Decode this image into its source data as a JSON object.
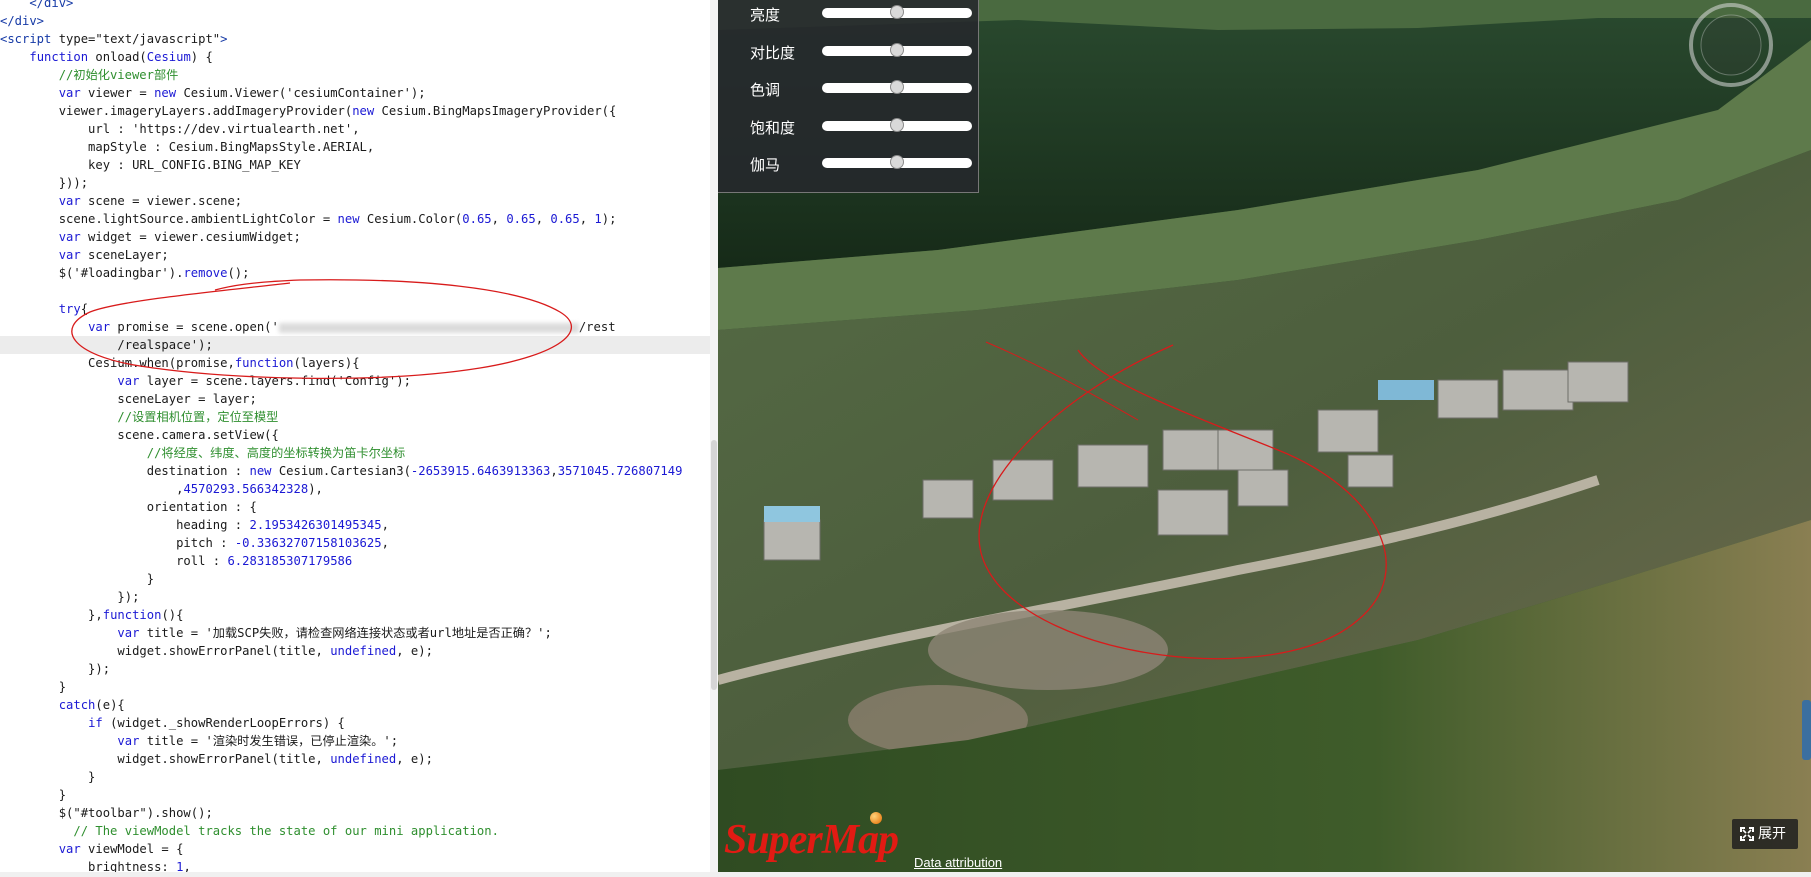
{
  "editor": {
    "lines": [
      [
        [
          "tag",
          "    </div>"
        ]
      ],
      [
        [
          "tag",
          "</div>"
        ]
      ],
      [
        [
          "tag",
          "<script "
        ],
        [
          "plain",
          "type=\"text/javascript\""
        ],
        [
          "tag",
          ">"
        ]
      ],
      [
        [
          "plain",
          "    "
        ],
        [
          "kw",
          "function"
        ],
        [
          "plain",
          " onload("
        ],
        [
          "kw",
          "Cesium"
        ],
        [
          "plain",
          ") {"
        ]
      ],
      [
        [
          "plain",
          "        "
        ],
        [
          "cm",
          "//初始化viewer部件"
        ]
      ],
      [
        [
          "plain",
          "        "
        ],
        [
          "kw",
          "var"
        ],
        [
          "plain",
          " viewer = "
        ],
        [
          "kw",
          "new"
        ],
        [
          "plain",
          " Cesium.Viewer('cesiumContainer');"
        ]
      ],
      [
        [
          "plain",
          "        viewer.imageryLayers.addImageryProvider("
        ],
        [
          "kw",
          "new"
        ],
        [
          "plain",
          " Cesium.BingMapsImageryProvider({"
        ]
      ],
      [
        [
          "plain",
          "            url : 'https://dev.virtualearth.net',"
        ]
      ],
      [
        [
          "plain",
          "            mapStyle : Cesium.BingMapsStyle.AERIAL,"
        ]
      ],
      [
        [
          "plain",
          "            key : URL_CONFIG.BING_MAP_KEY"
        ]
      ],
      [
        [
          "plain",
          "        }));"
        ]
      ],
      [
        [
          "plain",
          "        "
        ],
        [
          "kw",
          "var"
        ],
        [
          "plain",
          " scene = viewer.scene;"
        ]
      ],
      [
        [
          "plain",
          "        scene.lightSource.ambientLightColor = "
        ],
        [
          "kw",
          "new"
        ],
        [
          "plain",
          " Cesium.Color("
        ],
        [
          "num",
          "0.65"
        ],
        [
          "plain",
          ", "
        ],
        [
          "num",
          "0.65"
        ],
        [
          "plain",
          ", "
        ],
        [
          "num",
          "0.65"
        ],
        [
          "plain",
          ", "
        ],
        [
          "num",
          "1"
        ],
        [
          "plain",
          ");"
        ]
      ],
      [
        [
          "plain",
          "        "
        ],
        [
          "kw",
          "var"
        ],
        [
          "plain",
          " widget = viewer.cesiumWidget;"
        ]
      ],
      [
        [
          "plain",
          "        "
        ],
        [
          "kw",
          "var"
        ],
        [
          "plain",
          " sceneLayer;"
        ]
      ],
      [
        [
          "plain",
          "        $('#loadingbar')."
        ],
        [
          "fn",
          "remove"
        ],
        [
          "plain",
          "();"
        ]
      ],
      [
        [
          "plain",
          ""
        ]
      ],
      [
        [
          "plain",
          "        "
        ],
        [
          "kw",
          "try"
        ],
        [
          "plain",
          "{"
        ]
      ],
      [
        [
          "plain",
          "            "
        ],
        [
          "kw",
          "var"
        ],
        [
          "plain",
          " promise = scene.open('"
        ],
        [
          "blur",
          "300"
        ],
        [
          "plain",
          "/rest"
        ]
      ],
      [
        [
          "plain",
          "                /realspace');"
        ]
      ],
      [
        [
          "plain",
          "            Cesium.when(promise,"
        ],
        [
          "kw",
          "function"
        ],
        [
          "plain",
          "(layers){"
        ]
      ],
      [
        [
          "plain",
          "                "
        ],
        [
          "kw",
          "var"
        ],
        [
          "plain",
          " layer = scene.layers.find('Config');"
        ]
      ],
      [
        [
          "plain",
          "                sceneLayer = layer;"
        ]
      ],
      [
        [
          "plain",
          "                "
        ],
        [
          "cm",
          "//设置相机位置，定位至模型"
        ]
      ],
      [
        [
          "plain",
          "                scene.camera.setView({"
        ]
      ],
      [
        [
          "plain",
          "                    "
        ],
        [
          "cm",
          "//将经度、纬度、高度的坐标转换为笛卡尔坐标"
        ]
      ],
      [
        [
          "plain",
          "                    destination : "
        ],
        [
          "kw",
          "new"
        ],
        [
          "plain",
          " Cesium.Cartesian3("
        ],
        [
          "num",
          "-2653915.6463913363"
        ],
        [
          "plain",
          ","
        ],
        [
          "num",
          "3571045.726807149"
        ]
      ],
      [
        [
          "plain",
          "                        ,"
        ],
        [
          "num",
          "4570293.566342328"
        ],
        [
          "plain",
          "),"
        ]
      ],
      [
        [
          "plain",
          "                    orientation : {"
        ]
      ],
      [
        [
          "plain",
          "                        heading : "
        ],
        [
          "num",
          "2.1953426301495345"
        ],
        [
          "plain",
          ","
        ]
      ],
      [
        [
          "plain",
          "                        pitch : "
        ],
        [
          "num",
          "-0.33632707158103625"
        ],
        [
          "plain",
          ","
        ]
      ],
      [
        [
          "plain",
          "                        roll : "
        ],
        [
          "num",
          "6.283185307179586"
        ]
      ],
      [
        [
          "plain",
          "                    }"
        ]
      ],
      [
        [
          "plain",
          "                });"
        ]
      ],
      [
        [
          "plain",
          "            },"
        ],
        [
          "kw",
          "function"
        ],
        [
          "plain",
          "(){"
        ]
      ],
      [
        [
          "plain",
          "                "
        ],
        [
          "kw",
          "var"
        ],
        [
          "plain",
          " title = '加载SCP失败，请检查网络连接状态或者url地址是否正确？';"
        ]
      ],
      [
        [
          "plain",
          "                widget.showErrorPanel(title, "
        ],
        [
          "kw",
          "undefined"
        ],
        [
          "plain",
          ", e);"
        ]
      ],
      [
        [
          "plain",
          "            });"
        ]
      ],
      [
        [
          "plain",
          "        }"
        ]
      ],
      [
        [
          "plain",
          "        "
        ],
        [
          "kw",
          "catch"
        ],
        [
          "plain",
          "(e){"
        ]
      ],
      [
        [
          "plain",
          "            "
        ],
        [
          "kw",
          "if"
        ],
        [
          "plain",
          " (widget._showRenderLoopErrors) {"
        ]
      ],
      [
        [
          "plain",
          "                "
        ],
        [
          "kw",
          "var"
        ],
        [
          "plain",
          " title = '渲染时发生错误，已停止渲染。';"
        ]
      ],
      [
        [
          "plain",
          "                widget.showErrorPanel(title, "
        ],
        [
          "kw",
          "undefined"
        ],
        [
          "plain",
          ", e);"
        ]
      ],
      [
        [
          "plain",
          "            }"
        ]
      ],
      [
        [
          "plain",
          "        }"
        ]
      ],
      [
        [
          "plain",
          "        $(\"#toolbar\").show();"
        ]
      ],
      [
        [
          "plain",
          "          "
        ],
        [
          "cm",
          "// The viewModel tracks the state of our mini application."
        ]
      ],
      [
        [
          "plain",
          "        "
        ],
        [
          "kw",
          "var"
        ],
        [
          "plain",
          " viewModel = {"
        ]
      ],
      [
        [
          "plain",
          "            brightness: "
        ],
        [
          "num",
          "1"
        ],
        [
          "plain",
          ","
        ]
      ]
    ],
    "highlighted_line": 19
  },
  "map": {
    "adjust_panel": {
      "sliders": [
        {
          "label": "亮度",
          "value": 0.5
        },
        {
          "label": "对比度",
          "value": 0.5
        },
        {
          "label": "色调",
          "value": 0.5
        },
        {
          "label": "饱和度",
          "value": 0.5
        },
        {
          "label": "伽马",
          "value": 0.5
        }
      ]
    },
    "expand_label": "展开",
    "logo_text": "SuperMap",
    "attribution_text": "Data attribution",
    "colors": {
      "annotation": "#d81b1b",
      "river": "#1f3a22",
      "panel": "#26282c"
    }
  }
}
